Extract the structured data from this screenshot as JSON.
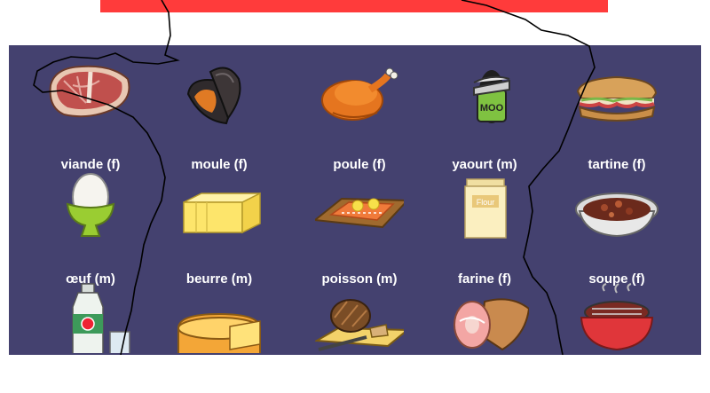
{
  "vocabulary": [
    {
      "word": "viande (f)",
      "icon": "steak-icon"
    },
    {
      "word": "moule (f)",
      "icon": "mussel-icon"
    },
    {
      "word": "poule (f)",
      "icon": "roast-chicken-icon"
    },
    {
      "word": "yaourt (m)",
      "icon": "yogurt-pot-icon"
    },
    {
      "word": "tartine (f)",
      "icon": "sandwich-icon"
    },
    {
      "word": "œuf (m)",
      "icon": "egg-cup-icon"
    },
    {
      "word": "beurre (m)",
      "icon": "butter-icon"
    },
    {
      "word": "poisson (m)",
      "icon": "salmon-fillet-icon"
    },
    {
      "word": "farine (f)",
      "icon": "flour-bag-icon"
    },
    {
      "word": "soupe (f)",
      "icon": "soup-bowl-icon"
    },
    {
      "icon": "milk-bottle-icon"
    },
    {
      "icon": "cheese-wheel-icon"
    },
    {
      "icon": "bread-board-icon"
    },
    {
      "icon": "ham-leg-icon"
    },
    {
      "icon": "grill-icon"
    }
  ],
  "images": {
    "yogurt_pot_text": "MOO",
    "flour_bag_text": "Flour"
  },
  "colors": {
    "banner": "#ff3b3b",
    "board": "#44416f",
    "label_text": "#ffffff"
  }
}
